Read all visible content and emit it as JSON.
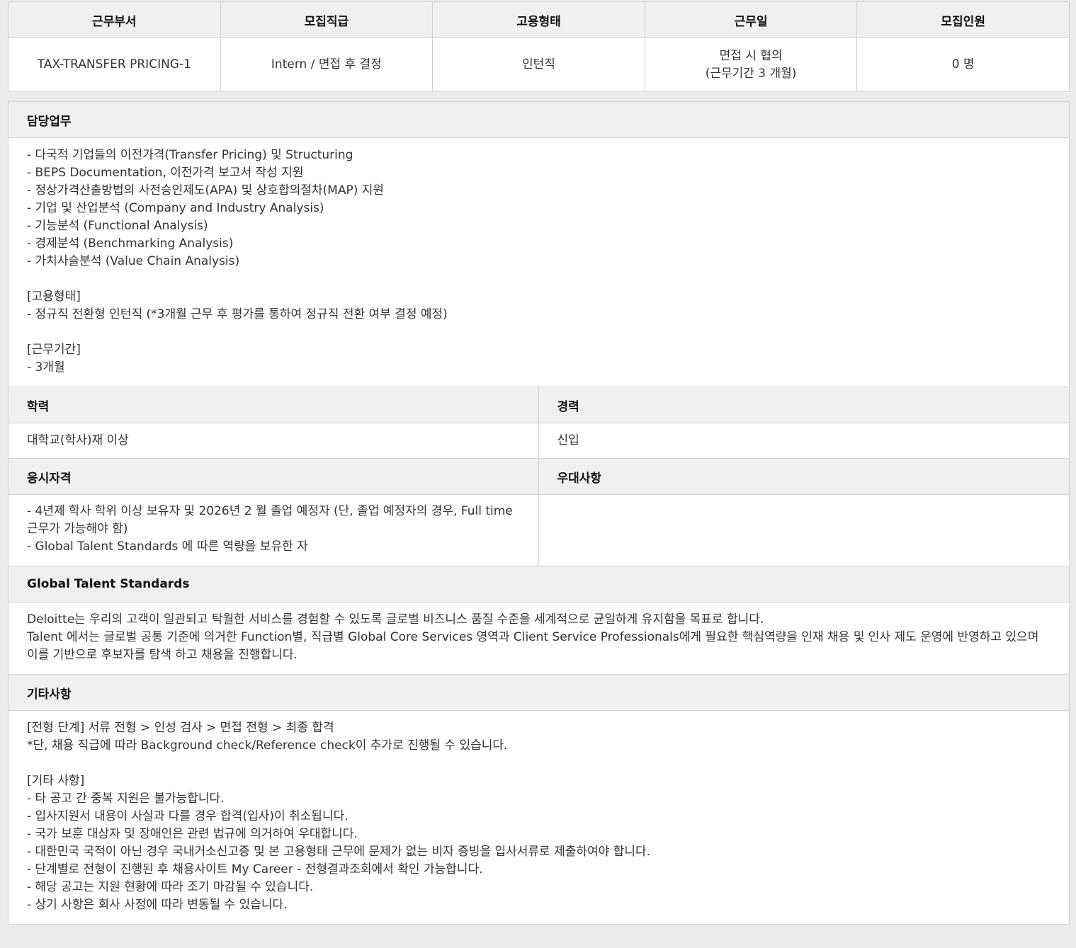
{
  "summary": {
    "headers": [
      "근무부서",
      "모집직급",
      "고용형태",
      "근무일",
      "모집인원"
    ],
    "values": [
      "TAX-TRANSFER PRICING-1",
      "Intern / 면접 후 결정",
      "인턴직",
      "면접 시 협의\n(근무기간 3 개월)",
      "0 명"
    ]
  },
  "duties": {
    "title": "담당업무",
    "text": "- 다국적 기업들의 이전가격(Transfer Pricing) 및 Structuring\n- BEPS Documentation, 이전가격 보고서 작성 지원\n- 정상가격산출방법의 사전승인제도(APA) 및 상호합의절차(MAP) 지원\n- 기업 및 산업분석 (Company and Industry Analysis)\n- 기능분석 (Functional Analysis)\n- 경제분석 (Benchmarking Analysis)\n- 가치사슬분석 (Value Chain Analysis)\n\n[고용형태]\n- 정규직 전환형 인턴직 (*3개월 근무 후 평가를 통하여 정규직 전환 여부 결정 예정)\n\n[근무기간]\n- 3개월"
  },
  "education": {
    "title": "학력",
    "text": "대학교(학사)재 이상"
  },
  "career": {
    "title": "경력",
    "text": "신입"
  },
  "qualification": {
    "title": "응시자격",
    "text": "- 4년제 학사 학위 이상 보유자 및 2026년 2 월 졸업 예정자 (단, 졸업 예정자의 경우, Full time 근무가 가능해야 함)\n- Global Talent Standards 에 따른 역량을 보유한 자"
  },
  "preference": {
    "title": "우대사항",
    "text": ""
  },
  "gts": {
    "title": "Global Talent Standards",
    "text": "Deloitte는 우리의 고객이 일관되고 탁월한 서비스를 경험할 수 있도록 글로벌 비즈니스 품질 수준을 세계적으로 균일하게 유지함을 목표로 합니다.\nTalent 에서는 글로벌 공통 기준에 의거한 Function별, 직급별 Global Core Services 영역과 Client Service Professionals에게 필요한 핵심역량을 인재 채용 및 인사 제도 운영에 반영하고 있으며\n이를 기반으로 후보자를 탐색 하고 채용을 진행합니다."
  },
  "etc": {
    "title": "기타사항",
    "text": "[전형 단계] 서류 전형 > 인성 검사 > 면접 전형 > 최종 합격\n*단, 채용 직급에 따라 Background check/Reference check이 추가로 진행될 수 있습니다.\n\n[기타 사항]\n- 타 공고 간 중복 지원은 불가능합니다.\n- 입사지원서 내용이 사실과 다를 경우 합격(입사)이 취소됩니다.\n- 국가 보훈 대상자 및 장애인은 관련 법규에 의거하여 우대합니다.\n- 대한민국 국적이 아닌 경우 국내거소신고증 및 본 고용형태 근무에 문제가 없는 비자 증빙을 입사서류로 제출하여야 합니다.\n- 단계별로 전형이 진행된 후 채용사이트 My Career - 전형결과조회에서 확인 가능합니다.\n- 해당 공고는 지원 현황에 따라 조기 마감될 수 있습니다.\n- 상기 사항은 회사 사정에 따라 변동될 수 있습니다."
  }
}
